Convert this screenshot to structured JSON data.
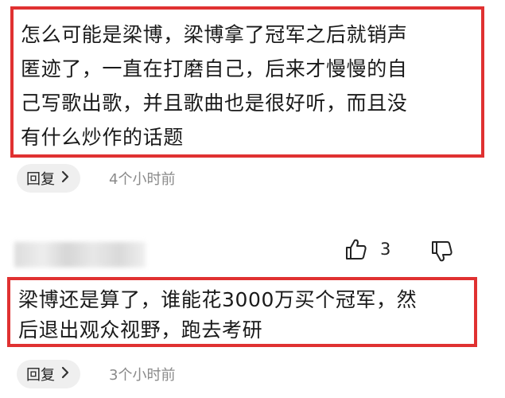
{
  "comments": [
    {
      "text": "怎么可能是梁博，梁博拿了冠军之后就销声匿迹了，一直在打磨自己，后来才慢慢的自己写歌出歌，并且歌曲也是很好听，而且没有什么炒作的话题",
      "lines": [
        "怎么可能是梁博，梁博拿了冠军之后就销声",
        "匿迹了，一直在打磨自己，后来才慢慢的自",
        "己写歌出歌，并且歌曲也是很好听，而且没",
        "有什么炒作的话题"
      ],
      "reply_label": "回复",
      "timestamp": "4个小时前"
    },
    {
      "text": "梁博还是算了，谁能花3000万买个冠军，然后退出观众视野，跑去考研",
      "lines": [
        "梁博还是算了，谁能花3000万买个冠军，然",
        "后退出观众视野，跑去考研"
      ],
      "like_count": "3",
      "reply_label": "回复",
      "timestamp": "3个小时前"
    }
  ],
  "icons": {
    "reply_chevron": "chevron-right-icon",
    "like": "thumbs-up-icon",
    "dislike": "thumbs-down-icon"
  },
  "colors": {
    "highlight_border": "#e03131",
    "reply_button_bg": "#efefef",
    "timestamp": "#8a8a8a"
  }
}
